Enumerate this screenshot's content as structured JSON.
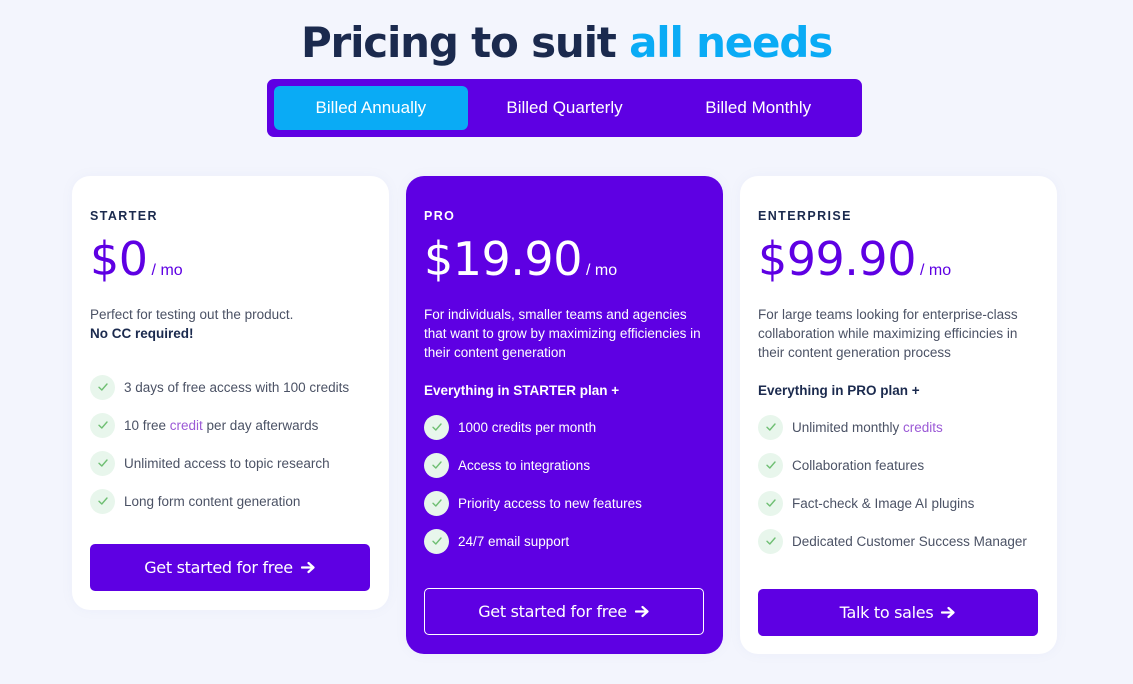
{
  "header": {
    "title_main": "Pricing to suit",
    "title_accent": "all needs"
  },
  "billing": {
    "tabs": [
      {
        "label": "Billed Annually",
        "active": true
      },
      {
        "label": "Billed Quarterly",
        "active": false
      },
      {
        "label": "Billed Monthly",
        "active": false
      }
    ]
  },
  "colors": {
    "primary": "#5e00e3",
    "accent": "#0aabf5",
    "heading": "#1b2a4e",
    "check_bg": "#e8f6ec",
    "check_mark": "#6fbf73",
    "highlight": "#9b59d6"
  },
  "plans": [
    {
      "name": "STARTER",
      "price": "$0",
      "period": "/ mo",
      "description": "Perfect for testing out the product.",
      "description_bold": "No CC required!",
      "features": [
        {
          "pre": "3 days of free access with 100 credits",
          "hl": "",
          "post": ""
        },
        {
          "pre": "10 free ",
          "hl": "credit",
          "post": " per day afterwards"
        },
        {
          "pre": "Unlimited access to topic research",
          "hl": "",
          "post": ""
        },
        {
          "pre": "Long form content generation",
          "hl": "",
          "post": ""
        }
      ],
      "cta": "Get started for free",
      "cta_icon": "arrow-right-icon"
    },
    {
      "name": "PRO",
      "price": "$19.90",
      "period": "/ mo",
      "description": "For individuals, smaller teams and agencies that want to grow by maximizing efficiencies in their content generation",
      "includes": "Everything in STARTER plan +",
      "features": [
        {
          "pre": "1000 credits per month",
          "hl": "",
          "post": ""
        },
        {
          "pre": "Access to integrations",
          "hl": "",
          "post": ""
        },
        {
          "pre": "Priority access to new features",
          "hl": "",
          "post": ""
        },
        {
          "pre": "24/7 email support",
          "hl": "",
          "post": ""
        }
      ],
      "cta": "Get started for free",
      "cta_icon": "arrow-right-icon"
    },
    {
      "name": "ENTERPRISE",
      "price": "$99.90",
      "period": "/ mo",
      "description": "For large teams looking for enterprise-class collaboration while maximizing efficincies in their content generation process",
      "includes": "Everything in PRO plan +",
      "features": [
        {
          "pre": "Unlimited monthly ",
          "hl": "credits",
          "post": ""
        },
        {
          "pre": "Collaboration features",
          "hl": "",
          "post": ""
        },
        {
          "pre": "Fact-check & Image AI plugins",
          "hl": "",
          "post": ""
        },
        {
          "pre": "Dedicated Customer Success Manager",
          "hl": "",
          "post": ""
        }
      ],
      "cta": "Talk to sales",
      "cta_icon": "arrow-right-icon"
    }
  ]
}
